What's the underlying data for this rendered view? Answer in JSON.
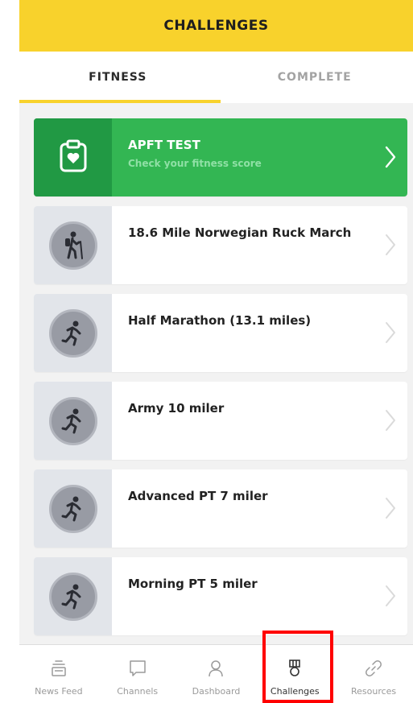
{
  "header": {
    "title": "CHALLENGES"
  },
  "tabs": [
    {
      "label": "FITNESS",
      "active": true
    },
    {
      "label": "COMPLETE",
      "active": false
    }
  ],
  "featured": {
    "title": "APFT TEST",
    "subtitle": "Check your fitness score",
    "icon": "clipboard-heart-icon",
    "color": "#33b653"
  },
  "challenges": [
    {
      "title": "18.6 Mile Norwegian Ruck March",
      "icon": "hiker-icon"
    },
    {
      "title": "Half Marathon (13.1 miles)",
      "icon": "runner-icon"
    },
    {
      "title": "Army 10 miler",
      "icon": "runner-icon"
    },
    {
      "title": "Advanced PT 7 miler",
      "icon": "runner-icon"
    },
    {
      "title": "Morning PT 5 miler",
      "icon": "runner-icon"
    }
  ],
  "bottom_nav": [
    {
      "label": "News Feed",
      "icon": "news-feed-icon",
      "active": false
    },
    {
      "label": "Channels",
      "icon": "chat-bubble-icon",
      "active": false
    },
    {
      "label": "Dashboard",
      "icon": "person-icon",
      "active": false
    },
    {
      "label": "Challenges",
      "icon": "medal-icon",
      "active": true
    },
    {
      "label": "Resources",
      "icon": "link-icon",
      "active": false
    }
  ],
  "colors": {
    "header": "#f8d22c",
    "accent_green": "#33b653",
    "highlight": "#ff0000"
  }
}
